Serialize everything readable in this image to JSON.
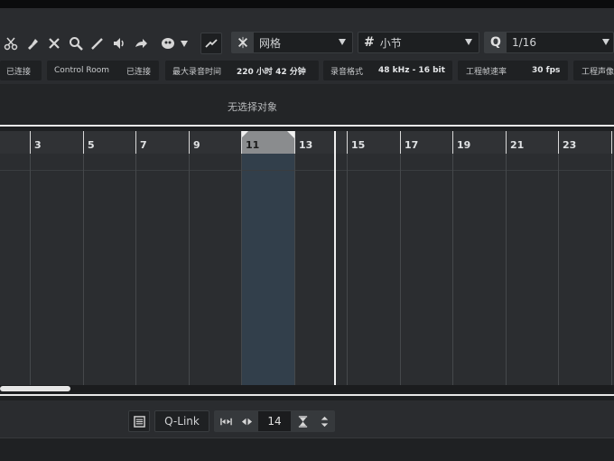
{
  "toolbar": {
    "tools": [
      {
        "name": "scissors-icon"
      },
      {
        "name": "glue-icon"
      },
      {
        "name": "erase-icon"
      },
      {
        "name": "zoom-icon"
      },
      {
        "name": "draw-pencil-icon"
      },
      {
        "name": "mute-speaker-icon"
      },
      {
        "name": "comp-tool-icon"
      },
      {
        "name": "color-palette-icon"
      }
    ],
    "snap_mode_label": "网格",
    "grid_type_label": "小节",
    "quantize_label": "1/16",
    "quantize_icon": "Q",
    "grid_icon": "#"
  },
  "status": {
    "connected_1": "已连接",
    "control_room_label": "Control Room",
    "connected_2": "已连接",
    "max_record_time_label": "最大录音时间",
    "max_record_time_value": "220 小时 42 分钟",
    "record_format_label": "录音格式",
    "record_format_value": "48 kHz - 16 bit",
    "frame_rate_label": "工程帧速率",
    "frame_rate_value": "30 fps",
    "pan_law_label": "工程声像"
  },
  "info_line": {
    "text": "无选择对象"
  },
  "ruler": {
    "bars": [
      "3",
      "5",
      "7",
      "9",
      "11",
      "13",
      "15",
      "17",
      "19",
      "21",
      "23"
    ]
  },
  "bottom": {
    "qlink_label": "Q-Link",
    "value_field": "14"
  },
  "colors": {
    "accent_selection": "#33414f",
    "ruler_selection": "#8a8c8e",
    "background": "#2b2d30"
  }
}
